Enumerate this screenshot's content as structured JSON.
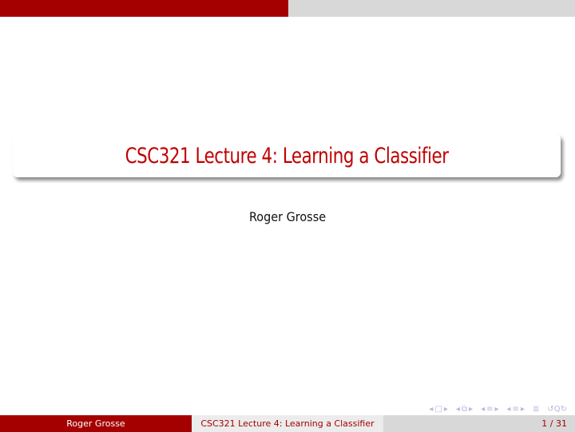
{
  "slide": {
    "title": "CSC321 Lecture 4: Learning a Classifier",
    "author": "Roger Grosse"
  },
  "nav": {
    "icons": [
      "slide-nav-icon",
      "frame-nav-icon",
      "subsection-nav-icon",
      "section-nav-icon",
      "outline-icon",
      "search-back-forward-icon"
    ],
    "glyphs": {
      "left": "◂",
      "right": "▸",
      "slide": "□",
      "frame": "⧉",
      "subsection": "≡",
      "section": "≡",
      "outline": "≣",
      "search": "↺Q↻"
    }
  },
  "footer": {
    "author": "Roger Grosse",
    "title": "CSC321 Lecture 4: Learning a Classifier",
    "page": "1 / 31"
  },
  "colors": {
    "accent": "#a40000",
    "title_text": "#c00000",
    "light_gray": "#ececec",
    "mid_gray": "#d8d8d8",
    "nav_icons": "#b8b8dc"
  }
}
